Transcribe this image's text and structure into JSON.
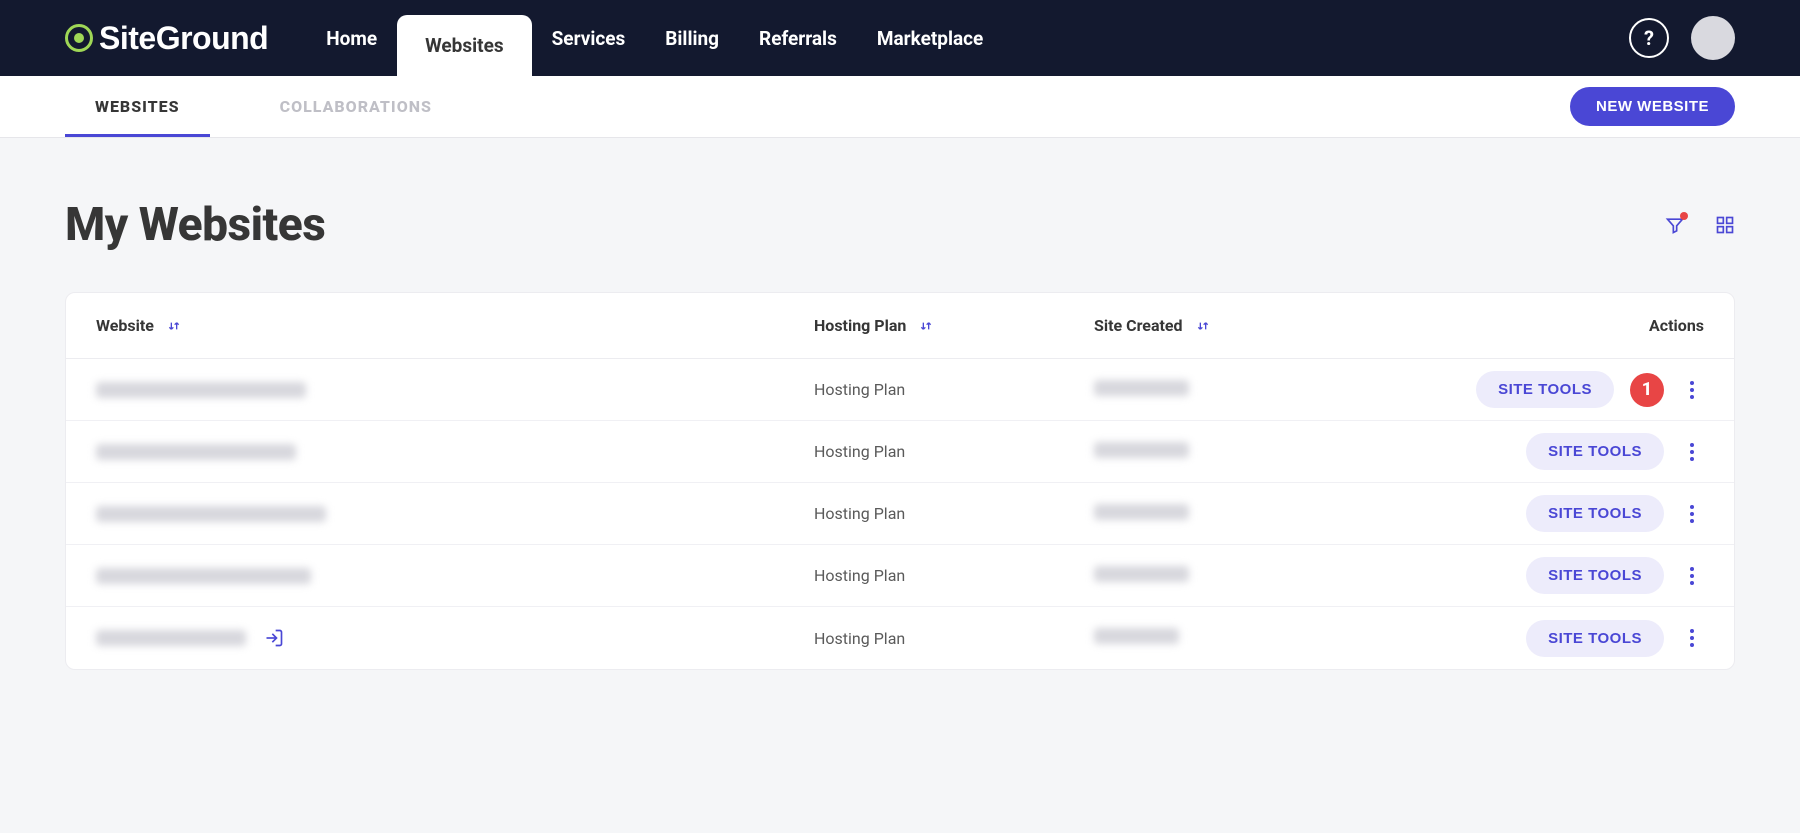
{
  "brand": "SiteGround",
  "nav": {
    "home": "Home",
    "websites": "Websites",
    "services": "Services",
    "billing": "Billing",
    "referrals": "Referrals",
    "marketplace": "Marketplace",
    "help_label": "?"
  },
  "subnav": {
    "websites": "WEBSITES",
    "collaborations": "COLLABORATIONS",
    "new_website": "NEW WEBSITE"
  },
  "page": {
    "title": "My Websites"
  },
  "table": {
    "headers": {
      "website": "Website",
      "hosting_plan": "Hosting Plan",
      "site_created": "Site Created",
      "actions": "Actions"
    },
    "site_tools_label": "SITE TOOLS",
    "rows": [
      {
        "website_redacted": true,
        "site_w": 210,
        "plan": "Hosting Plan",
        "date_redacted": true,
        "date_w": 95,
        "annotation": "1",
        "login_icon": false
      },
      {
        "website_redacted": true,
        "site_w": 200,
        "plan": "Hosting Plan",
        "date_redacted": true,
        "date_w": 95,
        "annotation": null,
        "login_icon": false
      },
      {
        "website_redacted": true,
        "site_w": 230,
        "plan": "Hosting Plan",
        "date_redacted": true,
        "date_w": 95,
        "annotation": null,
        "login_icon": false
      },
      {
        "website_redacted": true,
        "site_w": 215,
        "plan": "Hosting Plan",
        "date_redacted": true,
        "date_w": 95,
        "annotation": null,
        "login_icon": false
      },
      {
        "website_redacted": true,
        "site_w": 150,
        "plan": "Hosting Plan",
        "date_redacted": true,
        "date_w": 85,
        "annotation": null,
        "login_icon": true
      }
    ]
  }
}
